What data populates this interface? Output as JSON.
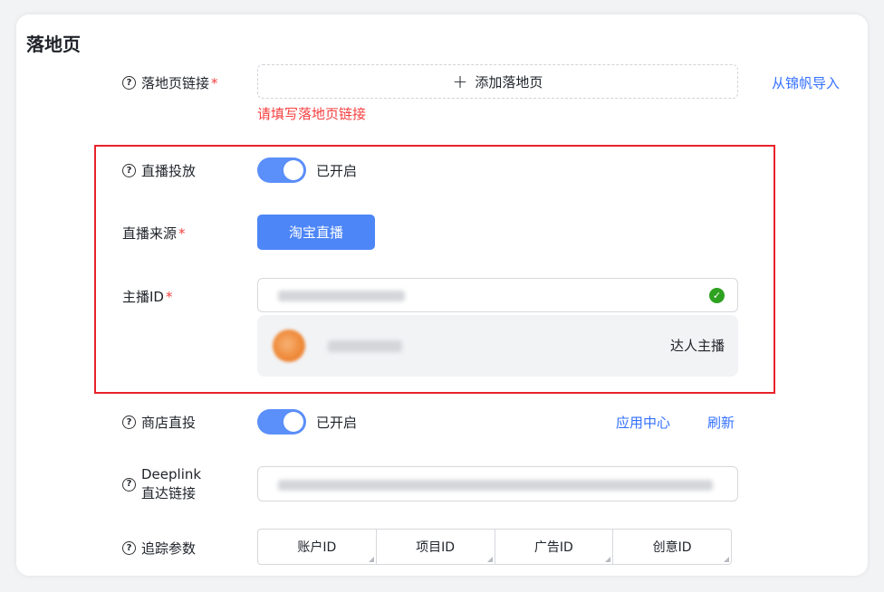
{
  "section_title": "落地页",
  "landing_page": {
    "label": "落地页链接",
    "required_mark": "*",
    "add_button": "添加落地页",
    "import_link": "从锦帆导入",
    "error": "请填写落地页链接"
  },
  "live_delivery": {
    "label": "直播投放",
    "toggle_state": "已开启"
  },
  "live_source": {
    "label": "直播来源",
    "required_mark": "*",
    "button": "淘宝直播"
  },
  "anchor_id": {
    "label": "主播ID",
    "required_mark": "*",
    "result_type": "达人主播"
  },
  "store_delivery": {
    "label": "商店直投",
    "toggle_state": "已开启",
    "app_center_link": "应用中心",
    "refresh_link": "刷新"
  },
  "deeplink": {
    "label_line1": "Deeplink",
    "label_line2": "直达链接"
  },
  "tracking": {
    "label": "追踪参数",
    "columns": [
      "账户ID",
      "项目ID",
      "广告ID",
      "创意ID"
    ]
  },
  "colors": {
    "accent": "#3370ff",
    "error": "#f53f3f",
    "highlight_border": "#e8222a",
    "toggle_on": "#5b8ff9",
    "success": "#2ea121"
  }
}
